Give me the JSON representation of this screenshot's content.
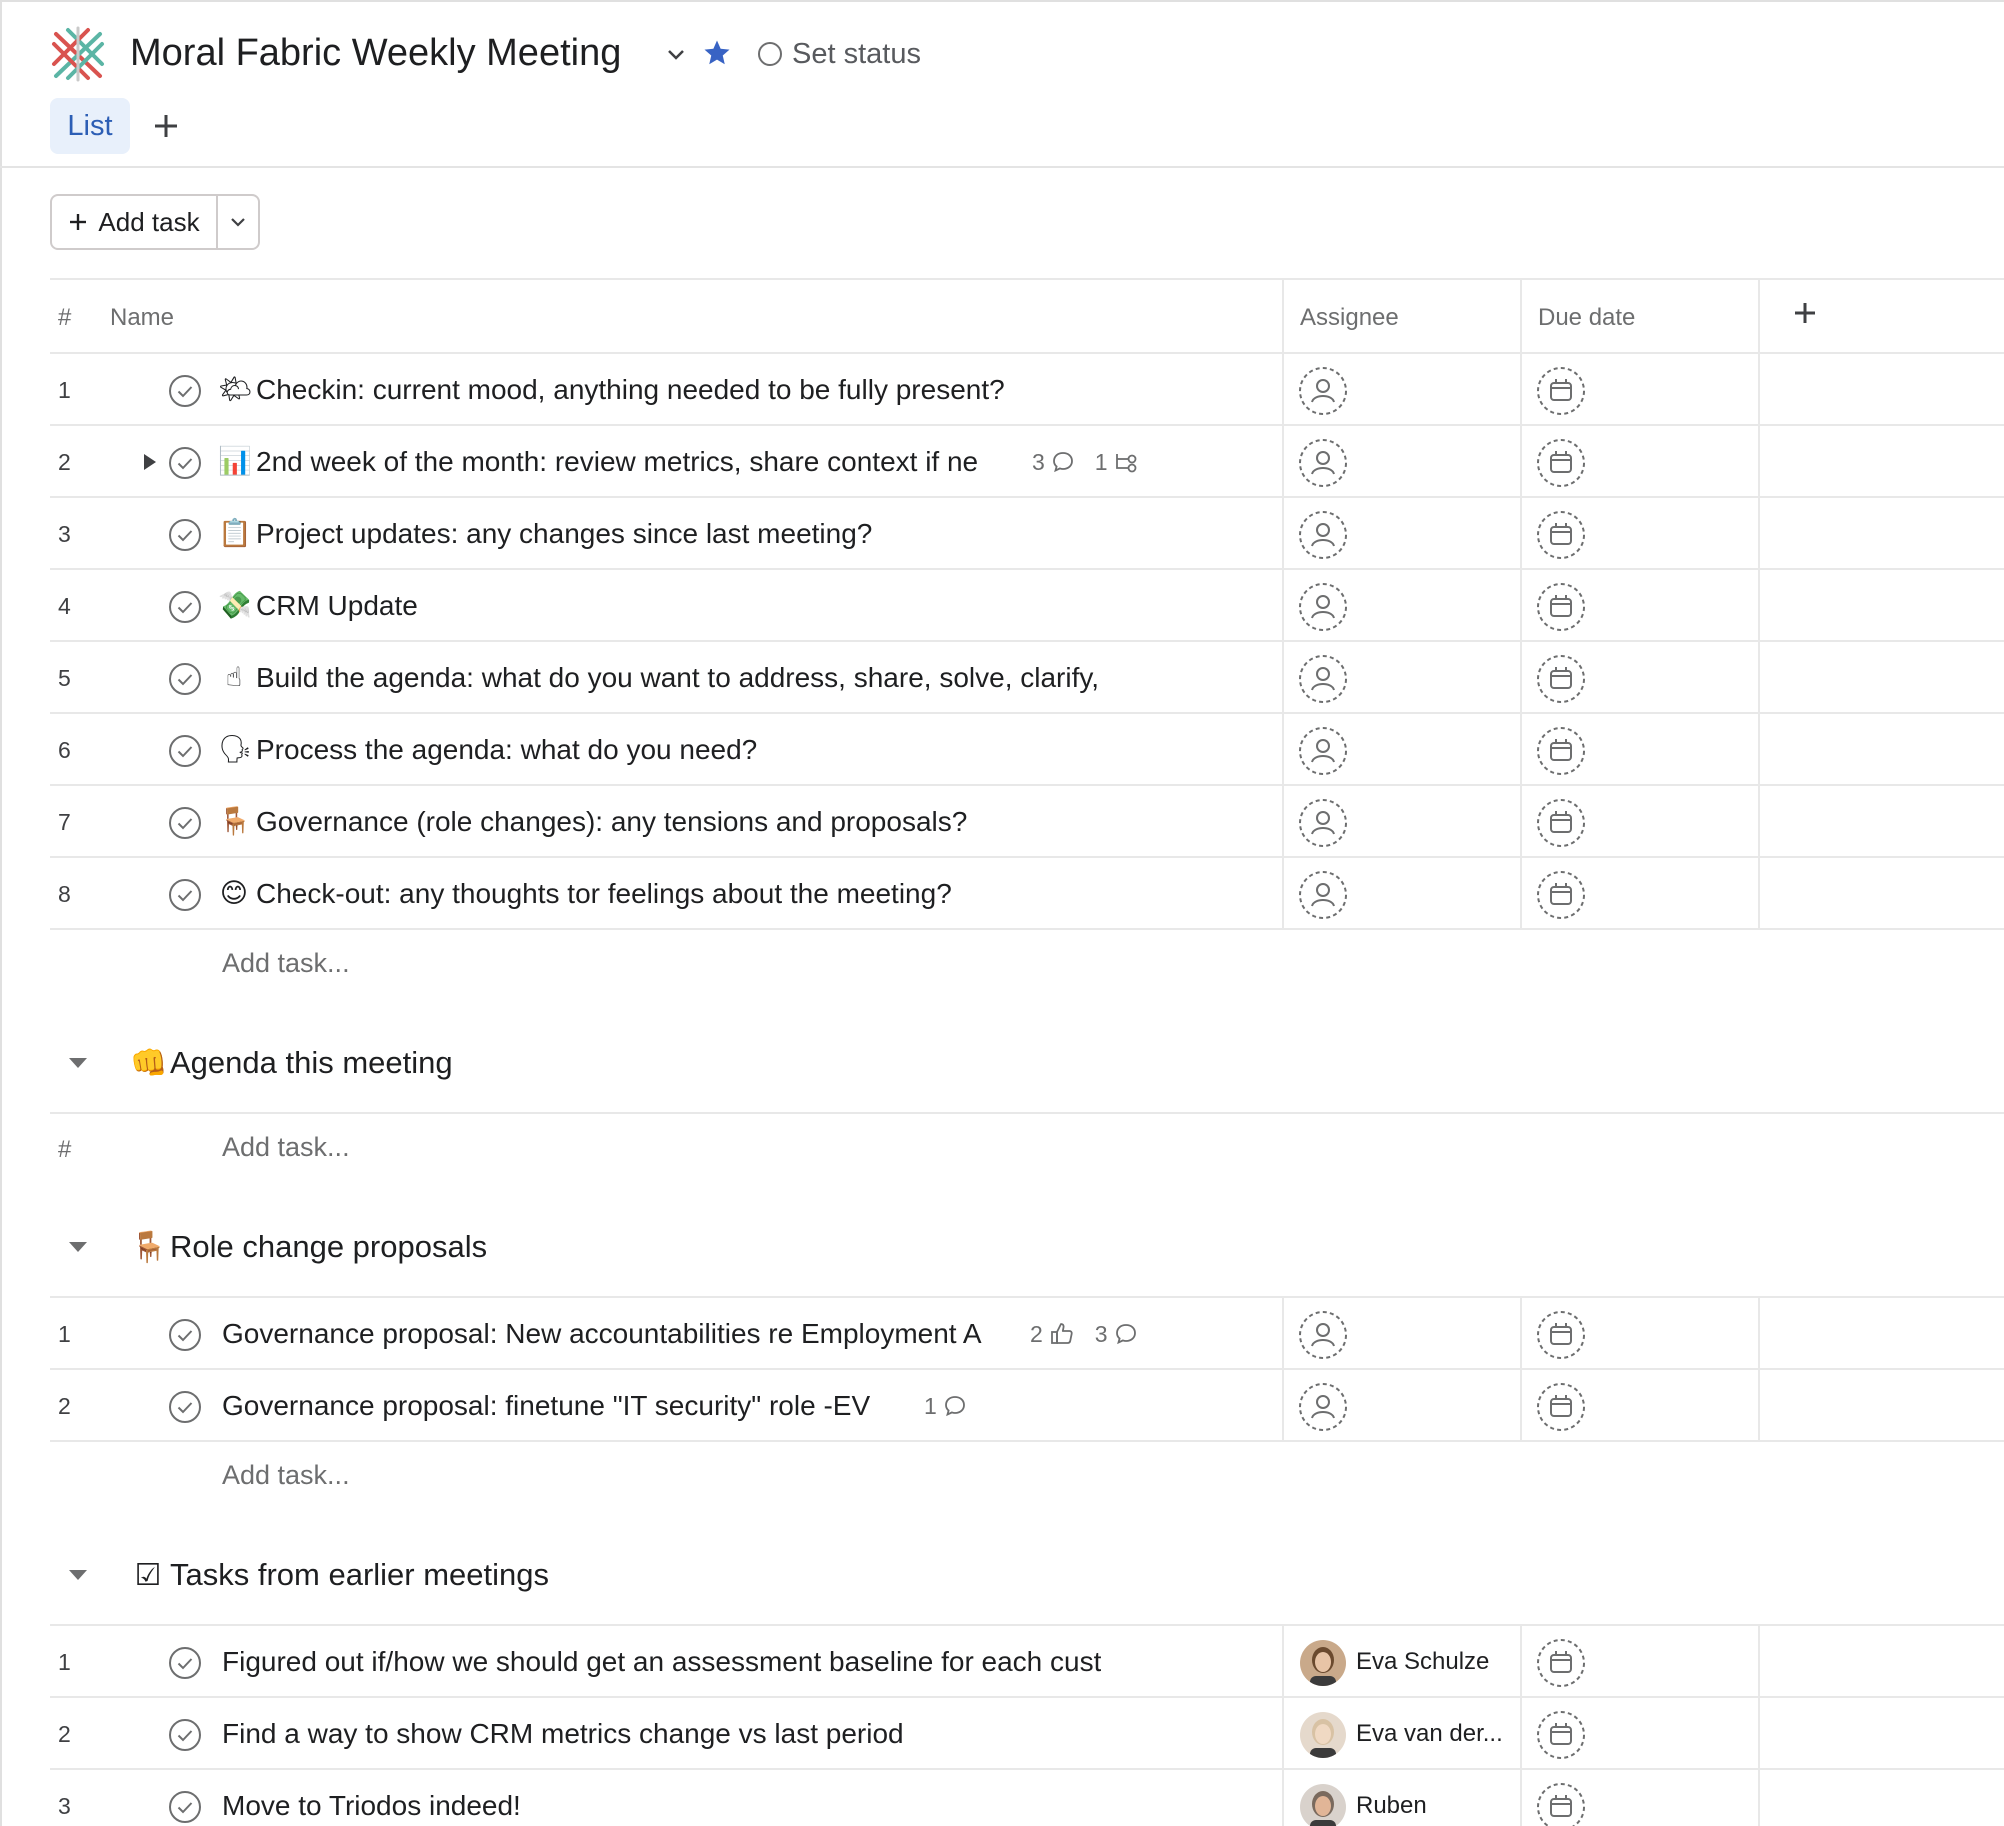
{
  "header": {
    "title": "Moral Fabric Weekly Meeting",
    "set_status": "Set status",
    "tab_list": "List"
  },
  "toolbar": {
    "add_task": "Add task"
  },
  "columns": {
    "hash": "#",
    "name": "Name",
    "assignee": "Assignee",
    "due_date": "Due date"
  },
  "add_task_placeholder": "Add task...",
  "main_tasks": [
    {
      "num": "1",
      "emoji": "🌤",
      "name": "Checkin: current mood, anything needed to be fully present?"
    },
    {
      "num": "2",
      "emoji": "📊",
      "name": "2nd week of the month: review metrics, share context if ne",
      "comments": "3",
      "subtasks": "1"
    },
    {
      "num": "3",
      "emoji": "📋",
      "name": "Project updates: any changes since last meeting?"
    },
    {
      "num": "4",
      "emoji": "💸",
      "name": "CRM Update"
    },
    {
      "num": "5",
      "emoji": "☝",
      "name": "Build the agenda: what do you want to address, share, solve, clarify,"
    },
    {
      "num": "6",
      "emoji": "🗣",
      "name": "Process the agenda: what do you need?"
    },
    {
      "num": "7",
      "emoji": "🪑",
      "name": "Governance (role changes): any tensions and proposals?"
    },
    {
      "num": "8",
      "emoji": "😊",
      "name": "Check-out: any thoughts tor feelings about the meeting?"
    }
  ],
  "sections": [
    {
      "emoji": "👊",
      "title": "Agenda this meeting"
    },
    {
      "emoji": "🪑",
      "title": "Role change proposals"
    },
    {
      "emoji": "☑",
      "title": "Tasks from earlier meetings"
    }
  ],
  "empty_hash": "#",
  "role_tasks": [
    {
      "num": "1",
      "name": "Governance proposal: New accountabilities re Employment A",
      "likes": "2",
      "comments": "3"
    },
    {
      "num": "2",
      "name": "Governance proposal: finetune \"IT security\" role -EV",
      "comments": "1"
    }
  ],
  "earlier_tasks": [
    {
      "num": "1",
      "name": "Figured out if/how we should get an assessment baseline for each cust",
      "assignee": "Eva Schulze"
    },
    {
      "num": "2",
      "name": "Find a way to show CRM metrics change vs last period",
      "assignee": "Eva van der..."
    },
    {
      "num": "3",
      "name": "Move to Triodos indeed!",
      "assignee": "Ruben"
    }
  ],
  "colors": {
    "accent": "#2c5eb5",
    "tab_bg": "#e8f0fb",
    "muted": "#6d6e6f",
    "border": "#e8e8e8"
  }
}
